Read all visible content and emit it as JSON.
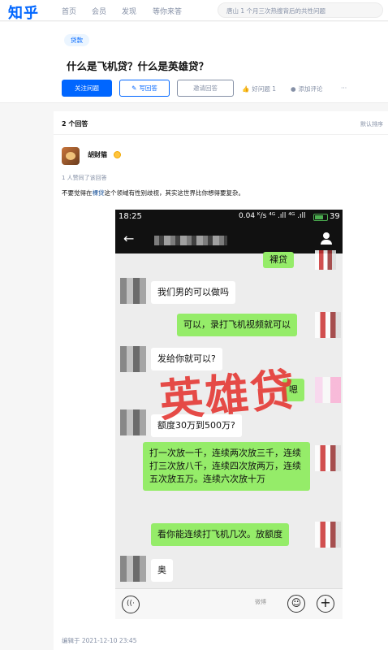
{
  "nav": {
    "logo": "知乎",
    "items": [
      "首页",
      "会员",
      "发现",
      "等你来答"
    ],
    "search_placeholder": "唐山 1 个月三次热搜背后的共性问题"
  },
  "question": {
    "topic": "贷款",
    "title": "什么是飞机贷？什么是英雄贷？",
    "follow_label": "关注问题",
    "write_label": "写回答",
    "invite_label": "邀请回答",
    "good_label": "好问题 1",
    "comment_label": "添加评论",
    "more_label": "···"
  },
  "answers": {
    "count_label": "2 个回答",
    "sort_label": "默认排序",
    "author": "胡财猫",
    "agree_text": "1 人赞同了该回答",
    "intro_pre": "不要觉得在",
    "intro_link": "裸贷",
    "intro_post": "这个领域有性别歧视，其实这世界比你想得要复杂。",
    "edited": "编辑于 2021-12-10 23:45"
  },
  "phone": {
    "time": "18:25",
    "status_info": "0.04 ᴷ/s ⁴ᴳ .ıll ⁴ᴳ .ıll",
    "battery": "39",
    "back": "←",
    "watermark": "英雄贷",
    "messages": [
      {
        "side": "right",
        "text": "裸贷"
      },
      {
        "side": "left",
        "text": "我们男的可以做吗"
      },
      {
        "side": "right",
        "text": "可以，录打飞机视频就可以"
      },
      {
        "side": "left",
        "text": "发给你就可以?"
      },
      {
        "side": "right",
        "text": "嗯"
      },
      {
        "side": "left",
        "text": "额度30万到500万?"
      },
      {
        "side": "right",
        "text": "打一次放一千，连续两次放三千，连续打三次放八千，连续四次放两万，连续五次放五万。连续六次放十万"
      },
      {
        "side": "right",
        "text": "看你能连续打飞机几次。放额度"
      },
      {
        "side": "left",
        "text": "奥"
      }
    ],
    "voice": "((·",
    "emoji": "☺",
    "plus": "+",
    "weibo": "微博"
  }
}
